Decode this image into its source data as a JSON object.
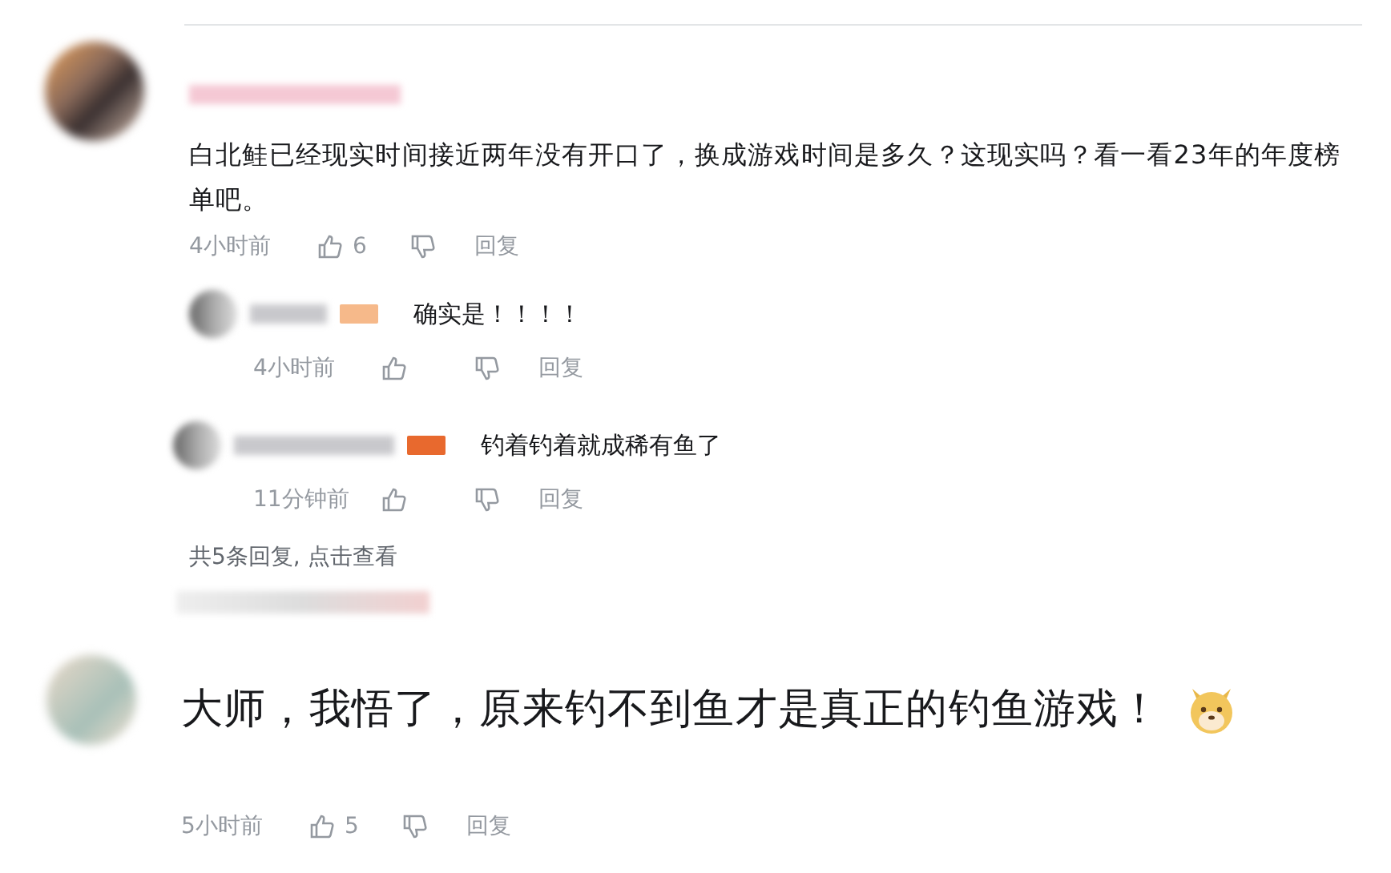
{
  "comments": [
    {
      "kind": "normal",
      "text": "白北鲑已经现实时间接近两年没有开口了，换成游戏时间是多久？这现实吗？看一看23年的年度榜单吧。",
      "time": "4小时前",
      "likes": "6",
      "reply_label": "回复",
      "replies": [
        {
          "text": "确实是！！！！",
          "time": "4小时前",
          "reply_label": "回复",
          "color": "#f6b98a"
        },
        {
          "text": "钓着钓着就成稀有鱼了",
          "time": "11分钟前",
          "reply_label": "回复",
          "color": "#e8692e"
        }
      ],
      "more_replies": "共5条回复, 点击查看"
    },
    {
      "kind": "large",
      "text": "大师，我悟了，原来钓不到鱼才是真正的钓鱼游戏！",
      "emoji": true,
      "time": "5小时前",
      "likes": "5",
      "reply_label": "回复"
    }
  ]
}
